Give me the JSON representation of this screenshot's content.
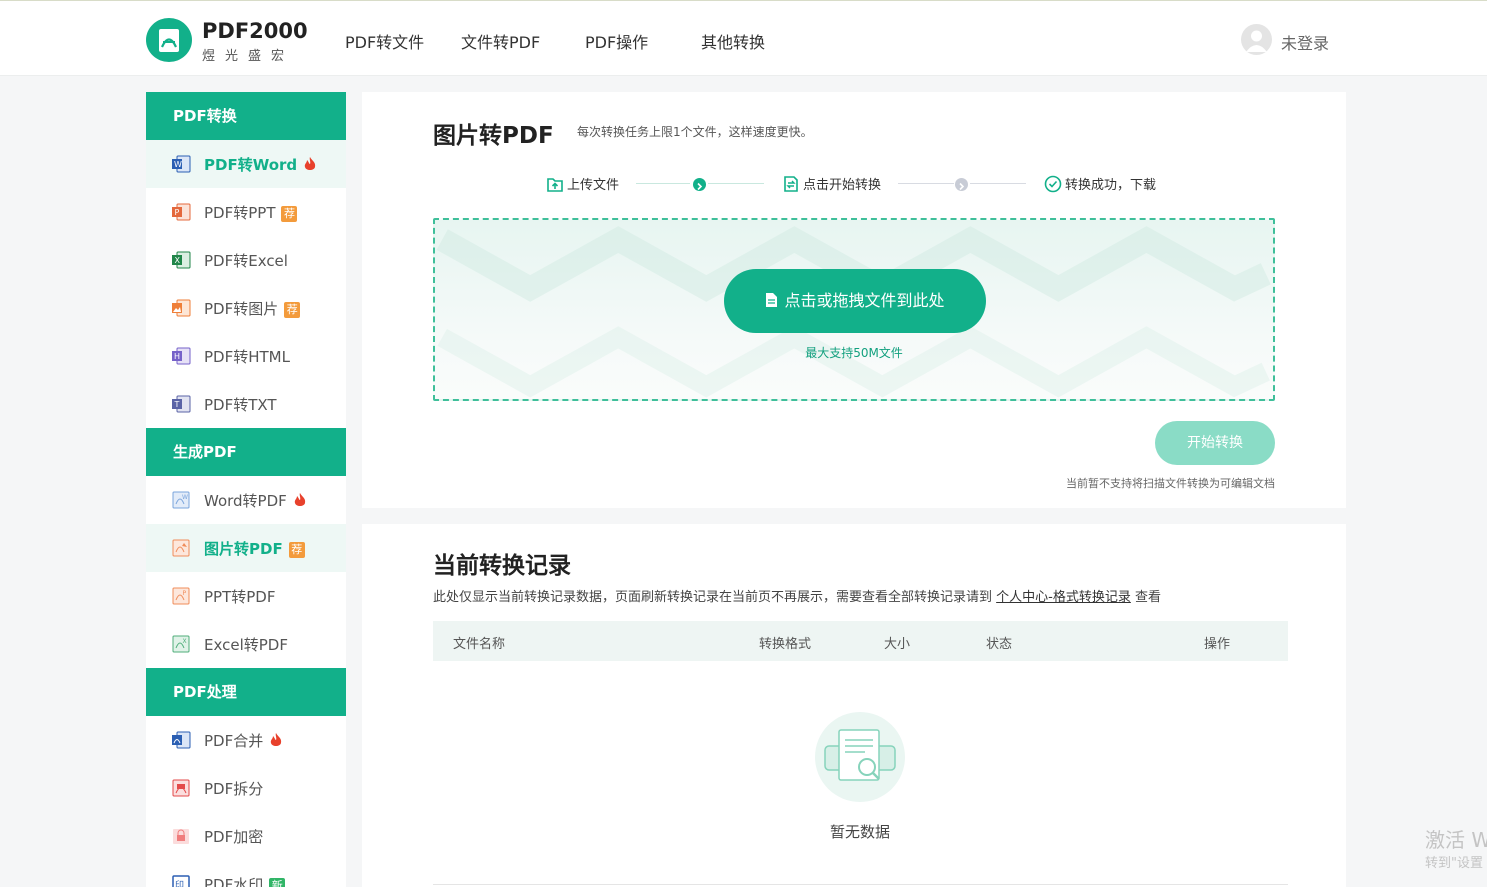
{
  "header": {
    "brand": "PDF2000",
    "brand_sub": "煜光盛宏",
    "nav": [
      "PDF转文件",
      "文件转PDF",
      "PDF操作",
      "其他转换"
    ],
    "user_label": "未登录"
  },
  "sidebar": {
    "groups": [
      {
        "title": "PDF转换"
      },
      {
        "title": "生成PDF"
      },
      {
        "title": "PDF处理"
      }
    ],
    "items": [
      {
        "label": "PDF转Word",
        "badge": "fire",
        "icon": "word-icon",
        "color": "#2b5fb3",
        "active": true
      },
      {
        "label": "PDF转PPT",
        "badge": "荐",
        "icon": "ppt-icon",
        "color": "#e4683c"
      },
      {
        "label": "PDF转Excel",
        "badge": "",
        "icon": "excel-icon",
        "color": "#21864a"
      },
      {
        "label": "PDF转图片",
        "badge": "荐",
        "icon": "image-icon",
        "color": "#ef7f39"
      },
      {
        "label": "PDF转HTML",
        "badge": "",
        "icon": "html-icon",
        "color": "#7662c9"
      },
      {
        "label": "PDF转TXT",
        "badge": "",
        "icon": "txt-icon",
        "color": "#5a63a6"
      },
      {
        "label": "Word转PDF",
        "badge": "fire",
        "icon": "word-to-pdf-icon",
        "color": "#7aa4dc"
      },
      {
        "label": "图片转PDF",
        "badge": "荐",
        "icon": "image-to-pdf-icon",
        "color": "#f08c5a",
        "active": true
      },
      {
        "label": "PPT转PDF",
        "badge": "",
        "icon": "ppt-to-pdf-icon",
        "color": "#f08c5a"
      },
      {
        "label": "Excel转PDF",
        "badge": "",
        "icon": "excel-to-pdf-icon",
        "color": "#4fae7a"
      },
      {
        "label": "PDF合并",
        "badge": "fire",
        "icon": "merge-icon",
        "color": "#2b5fb3"
      },
      {
        "label": "PDF拆分",
        "badge": "",
        "icon": "split-icon",
        "color": "#e34a4a"
      },
      {
        "label": "PDF加密",
        "badge": "",
        "icon": "lock-icon",
        "color": "#f07d7d"
      },
      {
        "label": "PDF水印",
        "badge": "新",
        "icon": "watermark-icon",
        "color": "#2b5fb3"
      }
    ]
  },
  "convert": {
    "title": "图片转PDF",
    "subtitle": "每次转换任务上限1个文件，这样速度更快。",
    "steps": [
      "上传文件",
      "点击开始转换",
      "转换成功，下载"
    ],
    "upload_label": "点击或拖拽文件到此处",
    "upload_note": "最大支持50M文件",
    "start_label": "开始转换",
    "start_note": "当前暂不支持将扫描文件转换为可编辑文档"
  },
  "records": {
    "title": "当前转换记录",
    "desc": "此处仅显示当前转换记录数据，页面刷新转换记录在当前页不再展示，需要查看全部转换记录请到",
    "link": "个人中心-格式转换记录",
    "desc_suffix": "查看",
    "columns": [
      "文件名称",
      "转换格式",
      "大小",
      "状态",
      "操作"
    ],
    "empty_text": "暂无数据"
  },
  "os_overlay": {
    "activate": "激活 W",
    "activate_sub": "转到\"设置"
  },
  "colors": {
    "accent": "#12b08a",
    "accent_light": "#8adcc6",
    "hot": "#e8412c"
  }
}
